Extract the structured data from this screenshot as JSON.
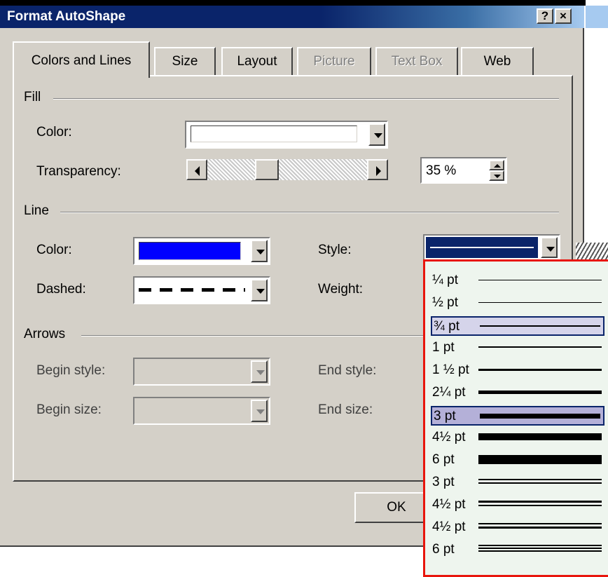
{
  "window": {
    "title": "Format AutoShape",
    "help_label": "?",
    "close_label": "×",
    "colors": {
      "titlebar": "#0a246a",
      "face": "#d4d0c8",
      "dropdown_border": "#e8150c",
      "dropdown_bg": "#eef5ee",
      "selected_item": "#b4b0d8"
    }
  },
  "tabs": [
    {
      "label": "Colors and Lines",
      "active": true,
      "enabled": true
    },
    {
      "label": "Size",
      "active": false,
      "enabled": true
    },
    {
      "label": "Layout",
      "active": false,
      "enabled": true
    },
    {
      "label": "Picture",
      "active": false,
      "enabled": false
    },
    {
      "label": "Text Box",
      "active": false,
      "enabled": false
    },
    {
      "label": "Web",
      "active": false,
      "enabled": true
    }
  ],
  "fill": {
    "section_label": "Fill",
    "color_label": "Color:",
    "color_value": "#ffffff",
    "transparency_label": "Transparency:",
    "transparency_value": "35 %",
    "transparency_level": 0.35
  },
  "line": {
    "section_label": "Line",
    "color_label": "Color:",
    "color_value": "#0000ff",
    "dashed_label": "Dashed:",
    "style_label": "Style:",
    "weight_label": "Weight:"
  },
  "arrows": {
    "section_label": "Arrows",
    "begin_style_label": "Begin style:",
    "begin_size_label": "Begin size:",
    "end_style_label": "End style:",
    "end_size_label": "End size:"
  },
  "buttons": {
    "ok_label": "OK"
  },
  "style_dropdown": {
    "items": [
      {
        "label": "¼ pt",
        "kind": "single",
        "thickness": 0.25
      },
      {
        "label": "½ pt",
        "kind": "single",
        "thickness": 0.5
      },
      {
        "label": "¾ pt",
        "kind": "single",
        "thickness": 0.75,
        "state": "hover"
      },
      {
        "label": "1 pt",
        "kind": "single",
        "thickness": 1
      },
      {
        "label": "1 ½ pt",
        "kind": "single",
        "thickness": 1.5
      },
      {
        "label": "2¼ pt",
        "kind": "single",
        "thickness": 2.25
      },
      {
        "label": "3 pt",
        "kind": "single",
        "thickness": 3,
        "state": "selected"
      },
      {
        "label": "4½ pt",
        "kind": "single",
        "thickness": 4.5
      },
      {
        "label": "6 pt",
        "kind": "single",
        "thickness": 6
      },
      {
        "label": "3 pt",
        "kind": "double",
        "thickness": 3
      },
      {
        "label": "4½ pt",
        "kind": "thick-thin",
        "thickness": 4.5
      },
      {
        "label": "4½ pt",
        "kind": "thin-thick",
        "thickness": 4.5
      },
      {
        "label": "6 pt",
        "kind": "triple",
        "thickness": 6
      }
    ]
  }
}
